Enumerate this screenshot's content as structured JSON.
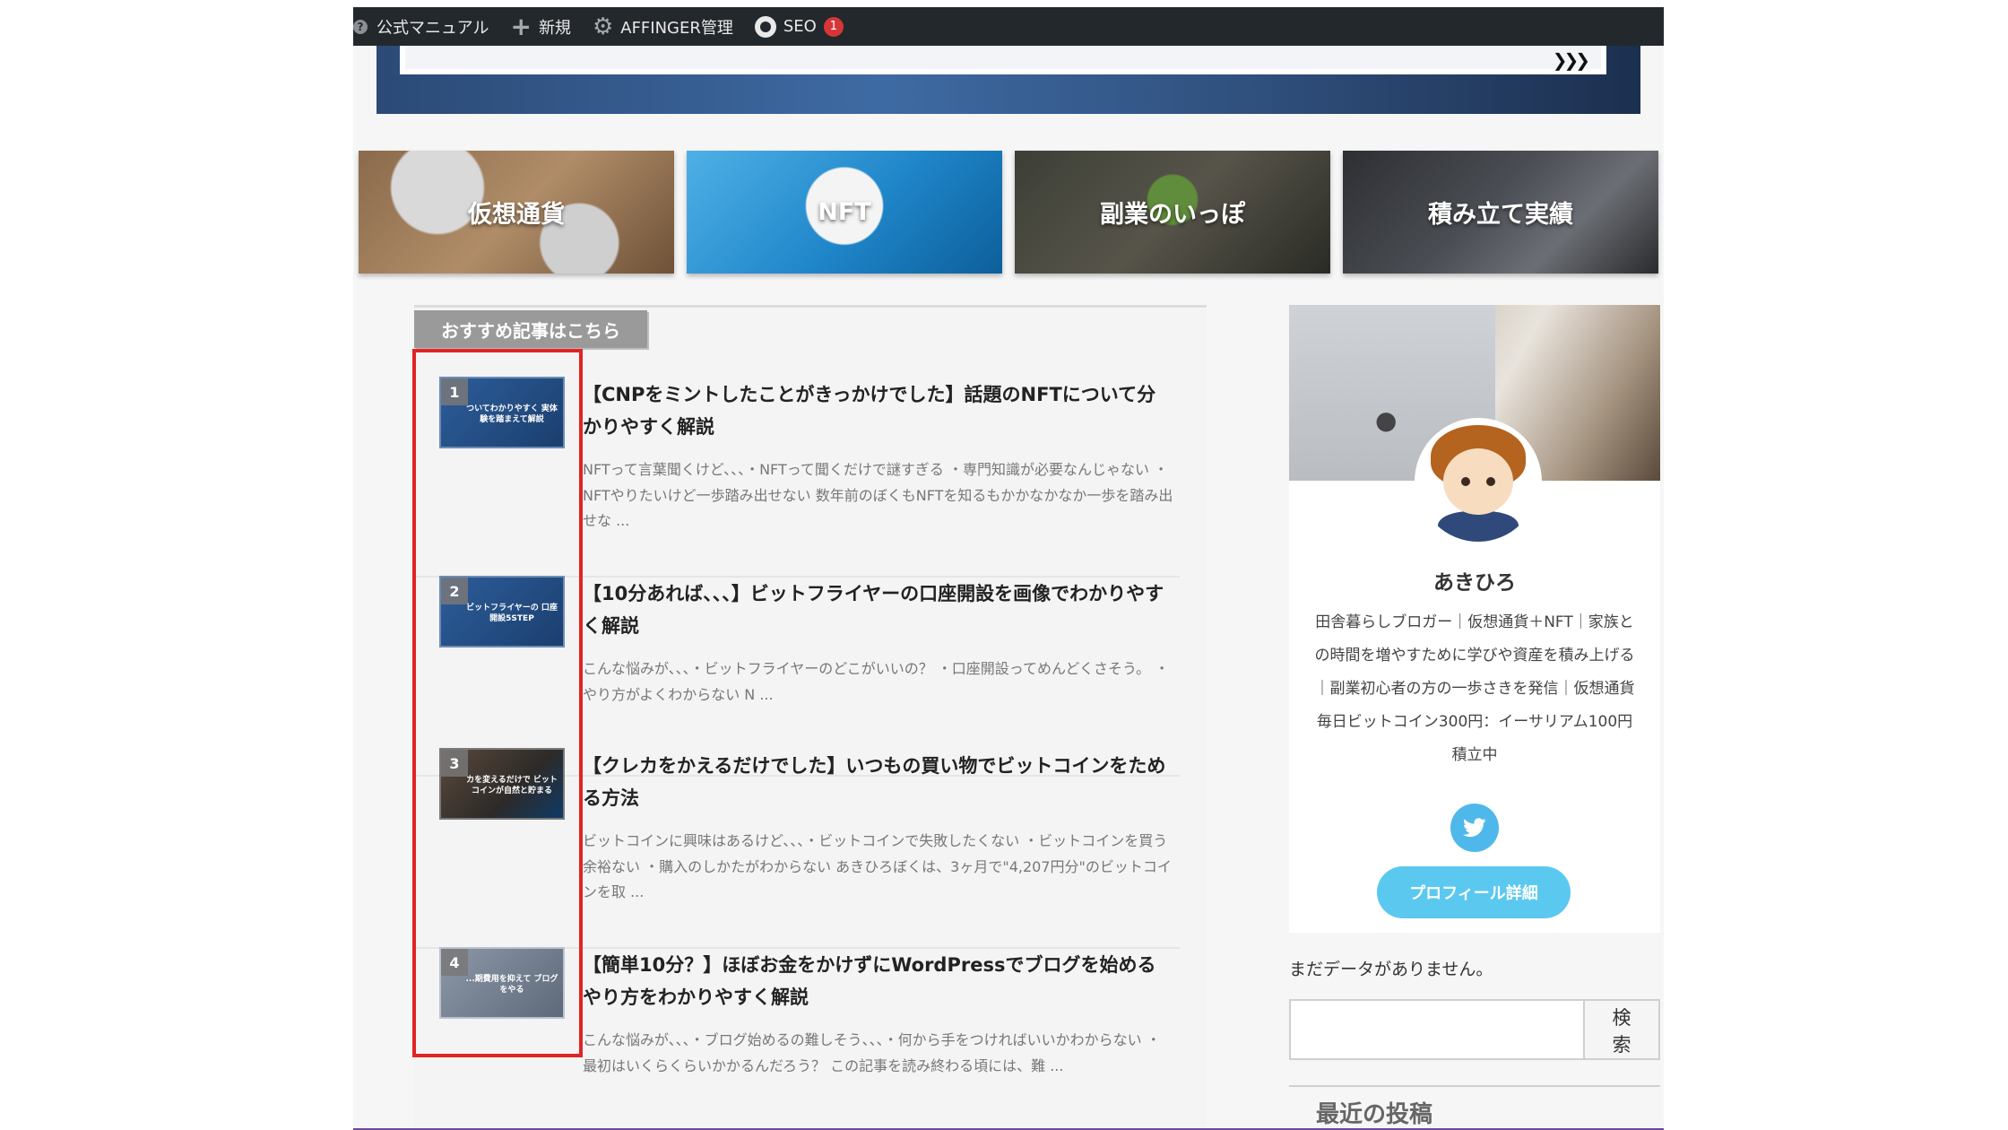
{
  "admin_bar": {
    "help_label": "?",
    "manual_label": "公式マニュアル",
    "new_label": "新規",
    "affinger_label": "AFFINGER管理",
    "seo_label": "SEO",
    "seo_count": "1"
  },
  "categories": [
    {
      "label": "仮想通貨"
    },
    {
      "label": "NFT"
    },
    {
      "label": "副業のいっぽ"
    },
    {
      "label": "積み立て実績"
    }
  ],
  "recommended": {
    "heading": "おすすめ記事はこちら",
    "articles": [
      {
        "rank": "1",
        "thumb_caption": "ついてわかりやすく 実体験を踏まえて解説",
        "title": "【CNPをミントしたことがきっかけでした】話題のNFTについて分かりやすく解説",
        "excerpt": "NFTって言葉聞くけど、、、・NFTって聞くだけで謎すぎる ・専門知識が必要なんじゃない ・NFTやりたいけど一歩踏み出せない 数年前のぼくもNFTを知るもかかなかなか一歩を踏み出せな ..."
      },
      {
        "rank": "2",
        "thumb_caption": "ビットフライヤーの 口座開設5STEP",
        "title": "【10分あれば、、、】ビットフライヤーの口座開設を画像でわかりやすく解説",
        "excerpt": "こんな悩みが、、、・ビットフライヤーのどこがいいの？ ・口座開設ってめんどくさそう。 ・やり方がよくわからない N ..."
      },
      {
        "rank": "3",
        "thumb_caption": "カを変えるだけで ビットコインが自然と貯まる",
        "title": "【クレカをかえるだけでした】いつもの買い物でビットコインをためる方法",
        "excerpt": "ビットコインに興味はあるけど、、、・ビットコインで失敗したくない ・ビットコインを買う余裕ない ・購入のしかたがわからない あきひろぼくは、3ヶ月で\"4,207円分\"のビットコインを取 ..."
      },
      {
        "rank": "4",
        "thumb_caption": "...期費用を抑えて ブログをやる",
        "title": "【簡単10分？】ほぼお金をかけずにWordPressでブログを始めるやり方をわかりやすく解説",
        "excerpt": "こんな悩みが、、、・ブログ始めるの難しそう、、、・何から手をつければいいかわからない ・最初はいくらくらいかかるんだろう？ この記事を読み終わる頃には、難 ..."
      }
    ]
  },
  "profile": {
    "name": "あきひろ",
    "bio": "田舎暮らしブロガー｜仮想通貨＋NFT｜家族との時間を増やすために学びや資産を積み上げる｜副業初心者の方の一歩さきを発信｜仮想通貨毎日ビットコイン300円：イーサリアム100円積立中",
    "twitter_icon": "twitter-icon",
    "detail_button": "プロフィール詳細"
  },
  "sidebar": {
    "no_data": "まだデータがありません。",
    "search_button": "検索",
    "search_value": "",
    "recent_heading": "最近の投稿"
  },
  "colors": {
    "admin_bar": "#23282d",
    "highlight_box": "#e02424",
    "accent_button": "#5bc8f0",
    "twitter": "#4fb8ea"
  }
}
